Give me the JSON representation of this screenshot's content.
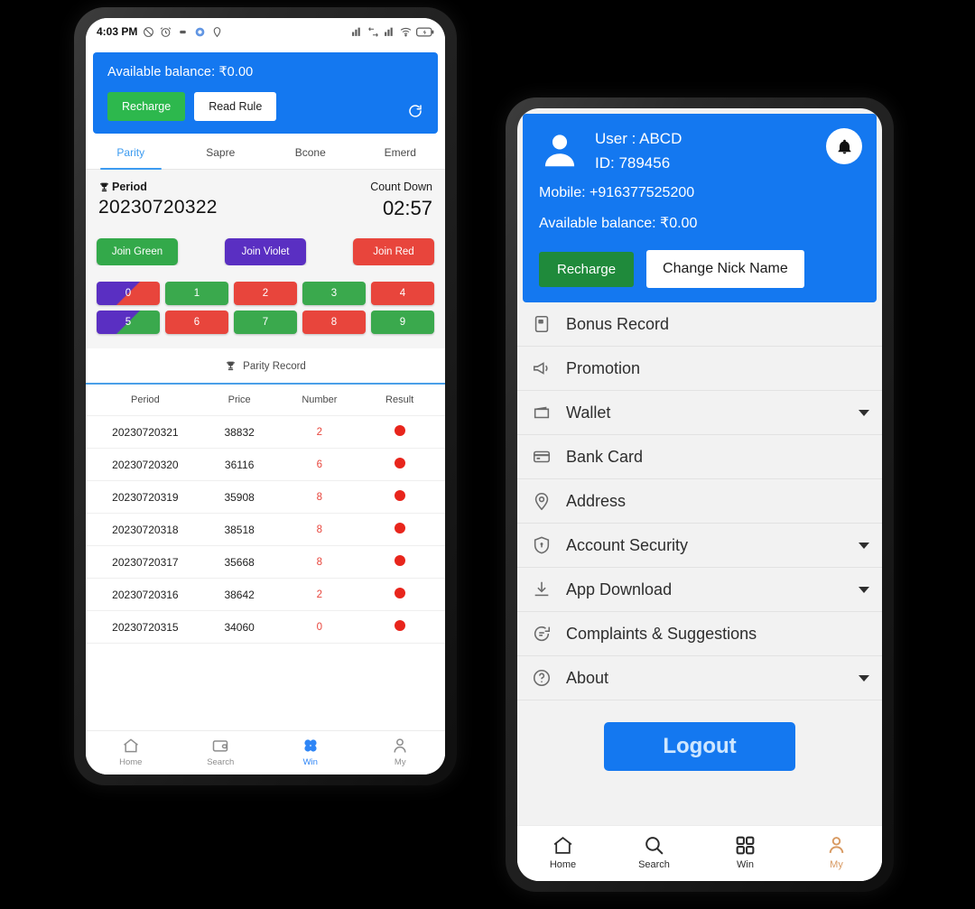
{
  "left_phone": {
    "statusbar": {
      "time": "4:03 PM",
      "left_icons": [
        "silent-mode-icon",
        "alarm-icon",
        "dnd-icon",
        "chrome-icon",
        "location-off-icon"
      ],
      "right_icons": [
        "signal-icon",
        "data-transfer-icon",
        "signal2-icon",
        "wifi-icon",
        "battery-charging-icon"
      ]
    },
    "balance_card": {
      "balance_text": "Available balance: ₹0.00",
      "recharge_label": "Recharge",
      "read_rule_label": "Read Rule",
      "refresh_icon": "refresh-icon",
      "bg_color": "#1478f0"
    },
    "tabs": [
      {
        "label": "Parity",
        "active": true
      },
      {
        "label": "Sapre",
        "active": false
      },
      {
        "label": "Bcone",
        "active": false
      },
      {
        "label": "Emerd",
        "active": false
      }
    ],
    "period": {
      "period_label": "Period",
      "period_icon": "trophy-icon",
      "period_number": "20230720322",
      "countdown_label": "Count Down",
      "countdown_value": "02:57"
    },
    "join_buttons": [
      {
        "label": "Join Green",
        "color": "#33a94a",
        "class": "join-green"
      },
      {
        "label": "Join Violet",
        "color": "#5a2fc2",
        "class": "join-violet"
      },
      {
        "label": "Join Red",
        "color": "#e8453c",
        "class": "join-red"
      }
    ],
    "number_buttons": [
      {
        "label": "0",
        "class": "n-violet-red"
      },
      {
        "label": "1",
        "class": "n-green"
      },
      {
        "label": "2",
        "class": "n-red"
      },
      {
        "label": "3",
        "class": "n-green"
      },
      {
        "label": "4",
        "class": "n-red"
      },
      {
        "label": "5",
        "class": "n-violet-green"
      },
      {
        "label": "6",
        "class": "n-red"
      },
      {
        "label": "7",
        "class": "n-green"
      },
      {
        "label": "8",
        "class": "n-red"
      },
      {
        "label": "9",
        "class": "n-green"
      }
    ],
    "record_header": {
      "label": "Parity Record",
      "icon": "trophy-icon"
    },
    "table": {
      "columns": [
        "Period",
        "Price",
        "Number",
        "Result"
      ],
      "rows": [
        {
          "period": "20230720321",
          "price": "38832",
          "number": "2",
          "result": "red"
        },
        {
          "period": "20230720320",
          "price": "36116",
          "number": "6",
          "result": "red"
        },
        {
          "period": "20230720319",
          "price": "35908",
          "number": "8",
          "result": "red"
        },
        {
          "period": "20230720318",
          "price": "38518",
          "number": "8",
          "result": "red"
        },
        {
          "period": "20230720317",
          "price": "35668",
          "number": "8",
          "result": "red"
        },
        {
          "period": "20230720316",
          "price": "38642",
          "number": "2",
          "result": "red"
        },
        {
          "period": "20230720315",
          "price": "34060",
          "number": "0",
          "result": "red"
        }
      ]
    },
    "bottom_nav": [
      {
        "label": "Home",
        "icon": "home-icon",
        "active": false
      },
      {
        "label": "Search",
        "icon": "wallet-icon",
        "active": false
      },
      {
        "label": "Win",
        "icon": "clover-icon",
        "active": true
      },
      {
        "label": "My",
        "icon": "person-icon",
        "active": false
      }
    ]
  },
  "right_phone": {
    "profile_card": {
      "avatar_icon": "person-avatar-icon",
      "user_line": "User : ABCD",
      "id_line": "ID: 789456",
      "mobile_line": "Mobile: +916377525200",
      "balance_line": "Available balance: ₹0.00",
      "bell_icon": "bell-icon",
      "recharge_label": "Recharge",
      "change_nick_label": "Change Nick Name",
      "bg_color": "#1478f0"
    },
    "menu_items": [
      {
        "label": "Bonus Record",
        "icon": "document-icon",
        "caret": false
      },
      {
        "label": "Promotion",
        "icon": "megaphone-icon",
        "caret": false
      },
      {
        "label": "Wallet",
        "icon": "wallet-icon",
        "caret": true
      },
      {
        "label": "Bank Card",
        "icon": "credit-card-icon",
        "caret": false
      },
      {
        "label": "Address",
        "icon": "location-pin-icon",
        "caret": false
      },
      {
        "label": "Account Security",
        "icon": "shield-icon",
        "caret": true
      },
      {
        "label": "App Download",
        "icon": "download-icon",
        "caret": true
      },
      {
        "label": "Complaints & Suggestions",
        "icon": "chat-bubble-icon",
        "caret": false
      },
      {
        "label": "About",
        "icon": "question-circle-icon",
        "caret": true
      }
    ],
    "logout_label": "Logout",
    "bottom_nav": [
      {
        "label": "Home",
        "icon": "home-icon",
        "active": false
      },
      {
        "label": "Search",
        "icon": "magnifier-icon",
        "active": false
      },
      {
        "label": "Win",
        "icon": "grid-icon",
        "active": false
      },
      {
        "label": "My",
        "icon": "person-icon",
        "active": true
      }
    ]
  }
}
